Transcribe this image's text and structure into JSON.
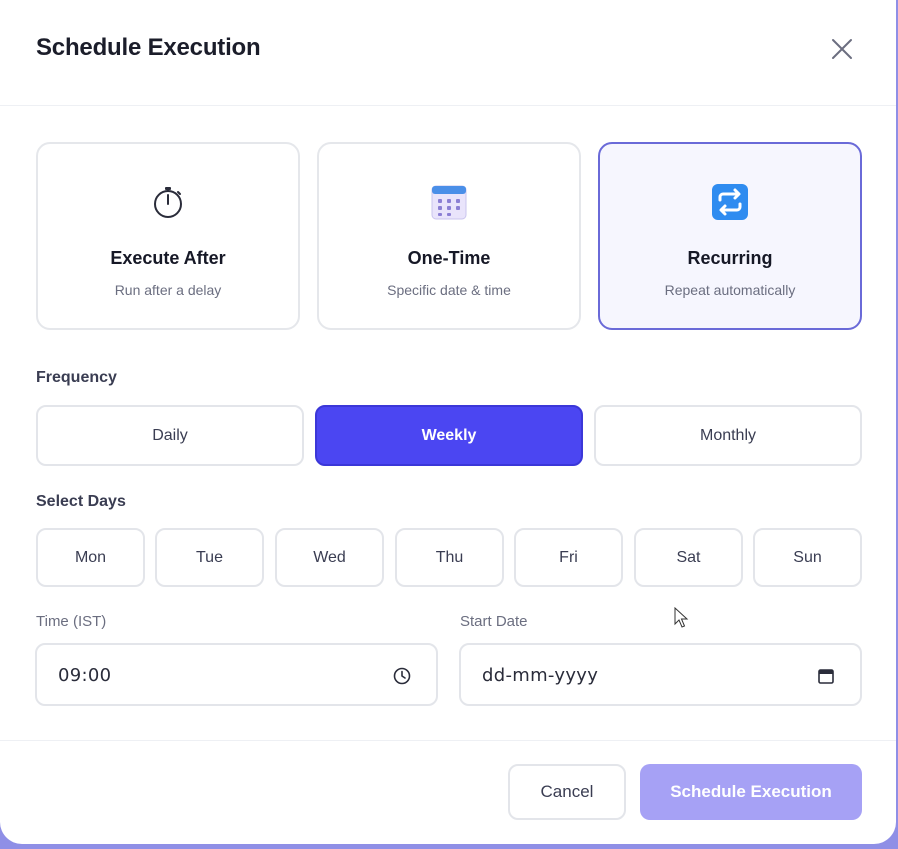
{
  "dialog": {
    "title": "Schedule Execution"
  },
  "schedule_types": [
    {
      "title": "Execute After",
      "subtitle": "Run after a delay",
      "icon": "stopwatch-icon"
    },
    {
      "title": "One-Time",
      "subtitle": "Specific date & time",
      "icon": "calendar-icon"
    },
    {
      "title": "Recurring",
      "subtitle": "Repeat automatically",
      "icon": "repeat-icon",
      "selected": true
    }
  ],
  "frequency": {
    "label": "Frequency",
    "options": [
      "Daily",
      "Weekly",
      "Monthly"
    ],
    "selected": "Weekly"
  },
  "days": {
    "label": "Select Days",
    "options": [
      "Mon",
      "Tue",
      "Wed",
      "Thu",
      "Fri",
      "Sat",
      "Sun"
    ]
  },
  "time": {
    "label": "Time (IST)",
    "value": "09:00",
    "icon": "clock-icon"
  },
  "start_date": {
    "label": "Start Date",
    "placeholder": "dd-mm-yyyy",
    "icon": "calendar-small-icon"
  },
  "footer": {
    "cancel_label": "Cancel",
    "submit_label": "Schedule Execution"
  },
  "colors": {
    "accent": "#4b46f2",
    "accent_disabled": "#a6a1f5",
    "selected_border": "#6a6ad8",
    "backdrop": "#8f8fe6"
  }
}
